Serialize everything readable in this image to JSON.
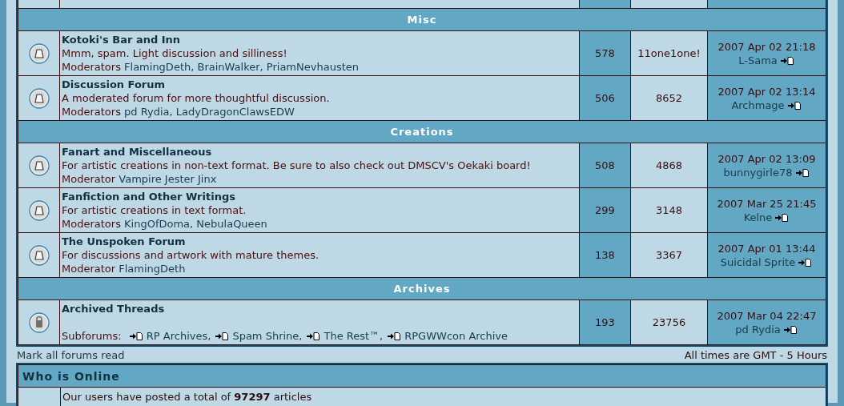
{
  "categories": [
    {
      "name": "Misc",
      "forums": [
        {
          "kind": "normal",
          "title": "Kotoki's Bar and Inn",
          "description": "Mmm, spam. Light discussion and silliness!",
          "moderators_label": "Moderators",
          "moderators": "FlamingDeth, BrainWalker, PriamNevhausten",
          "topics": "578",
          "posts": "11one1one!",
          "last_post": {
            "date": "2007 Apr 02 21:18",
            "user": "L-Sama"
          }
        },
        {
          "kind": "normal",
          "title": "Discussion Forum",
          "description": "A moderated forum for more thoughtful discussion.",
          "moderators_label": "Moderators",
          "moderators": "pd Rydia, LadyDragonClawsEDW",
          "topics": "506",
          "posts": "8652",
          "last_post": {
            "date": "2007 Apr 02 13:14",
            "user": "Archmage"
          }
        }
      ]
    },
    {
      "name": "Creations",
      "forums": [
        {
          "kind": "normal",
          "title": "Fanart and Miscellaneous",
          "description": "For artistic creations in non-text format. Be sure to also check out DMSCV's Oekaki board!",
          "moderators_label": "Moderator",
          "moderators": "Vampire Jester Jinx",
          "topics": "508",
          "posts": "4868",
          "last_post": {
            "date": "2007 Apr 02 13:09",
            "user": "bunnygirle78"
          }
        },
        {
          "kind": "normal",
          "title": "Fanfiction and Other Writings",
          "description": "For artistic creations in text format.",
          "moderators_label": "Moderators",
          "moderators": "KingOfDoma, NebulaQueen",
          "topics": "299",
          "posts": "3148",
          "last_post": {
            "date": "2007 Mar 25 21:45",
            "user": "Kelne"
          }
        },
        {
          "kind": "normal",
          "title": "The Unspoken Forum",
          "description": "For discussions and artwork with mature themes.",
          "moderators_label": "Moderator",
          "moderators": "FlamingDeth",
          "topics": "138",
          "posts": "3367",
          "last_post": {
            "date": "2007 Apr 01 13:44",
            "user": "Suicidal Sprite"
          }
        }
      ]
    },
    {
      "name": "Archives",
      "forums": [
        {
          "kind": "locked",
          "title": "Archived Threads",
          "subforums_label": "Subforums:",
          "subforums": [
            "RP Archives,",
            "Spam Shrine,",
            "The Rest™,",
            "RPGWWcon Archive"
          ],
          "topics": "193",
          "posts": "23756",
          "last_post": {
            "date": "2007 Mar 04 22:47",
            "user": "pd Rydia"
          }
        }
      ]
    }
  ],
  "mark_read": "Mark all forums read",
  "timezone": "All times are GMT - 5 Hours",
  "who_is_online": {
    "title": "Who is Online",
    "stats": "Our users have posted a total of **97297** articles"
  }
}
